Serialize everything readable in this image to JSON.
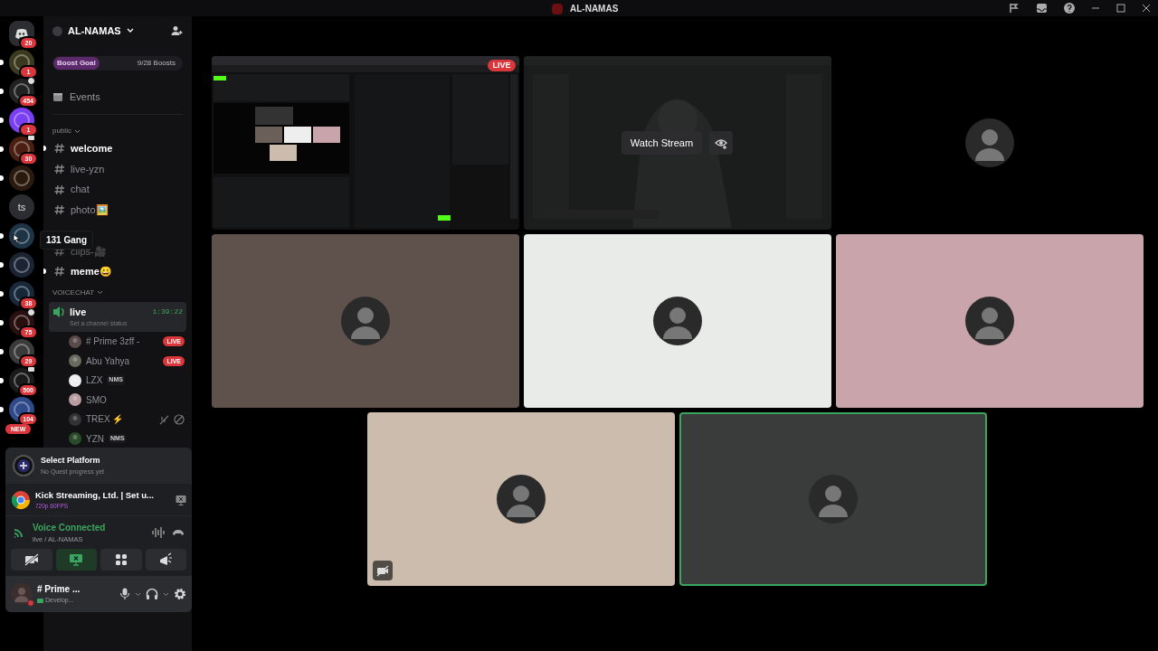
{
  "window": {
    "title": "AL-NAMAS"
  },
  "servers": [
    {
      "kind": "home",
      "badge": "20",
      "unread": false,
      "color": "#2b2d31"
    },
    {
      "kind": "server",
      "badge": "1",
      "unread": true,
      "color": "#3b3a1e"
    },
    {
      "kind": "server",
      "badge": "454",
      "unread": true,
      "speaker": true,
      "color": "#222222"
    },
    {
      "kind": "server",
      "badge": "1",
      "unread": true,
      "color": "#7b3ff2"
    },
    {
      "kind": "server",
      "badge": "30",
      "unread": true,
      "screen": true,
      "color": "#4a1e10"
    },
    {
      "kind": "server",
      "unread": true,
      "color": "#2a1a0e"
    },
    {
      "kind": "text",
      "text": "ts",
      "unread": false,
      "color": "#2b2d31"
    },
    {
      "kind": "server",
      "unread": true,
      "tooltip": "131 Gang",
      "color": "#1d3346"
    },
    {
      "kind": "server",
      "unread": true,
      "color": "#1b2433"
    },
    {
      "kind": "server",
      "badge": "38",
      "unread": true,
      "color": "#16283a"
    },
    {
      "kind": "server",
      "badge": "75",
      "unread": true,
      "speaker": true,
      "color": "#2a0f0f"
    },
    {
      "kind": "server",
      "badge": "29",
      "unread": true,
      "color": "#3a3a3a"
    },
    {
      "kind": "server",
      "badge": "500",
      "unread": true,
      "screen": true,
      "color": "#1a1a1a"
    },
    {
      "kind": "server",
      "badge": "104",
      "unread": true,
      "color": "#2f4a8a",
      "new_label": "NEW"
    }
  ],
  "guild": {
    "name": "AL-NAMAS",
    "boost_label": "Boost Goal",
    "boost_count": "9/28 Boosts",
    "events": "Events"
  },
  "categories": [
    {
      "name": "public",
      "kind": "text",
      "channels": [
        {
          "name": "welcome",
          "unread": true
        },
        {
          "name": "live-yzn",
          "unread": false
        },
        {
          "name": "chat",
          "unread": false
        },
        {
          "name": "photo🖼️",
          "unread": false
        },
        {
          "name": "clips-🎥",
          "unread": false,
          "faded": true
        },
        {
          "name": "meme😀",
          "unread": true
        }
      ]
    },
    {
      "name": "VOICECHAT",
      "kind": "voice",
      "channel": {
        "name": "live",
        "timer": "1:39:22",
        "status": "Set a channel status"
      },
      "users": [
        {
          "name": "# Prime 3zff -",
          "badge": "LIVE",
          "color": "#5a4a4a"
        },
        {
          "name": "Abu Yahya",
          "badge": "LIVE",
          "color": "#6a6a60"
        },
        {
          "name": "LZX",
          "tag": "NMS",
          "color": "#eeeeee"
        },
        {
          "name": "SMO",
          "color": "#b99ca0"
        },
        {
          "name": "TREX ⚡",
          "muted": true,
          "color": "#333333"
        },
        {
          "name": "YZN",
          "tag": "NMS",
          "color": "#2a4a2a"
        }
      ]
    }
  ],
  "quest": {
    "title": "Select Platform",
    "subtitle": "No Quest progress yet"
  },
  "activity": {
    "title": "Kick Streaming, Ltd. | Set u...",
    "quality": "720p 60FPS"
  },
  "voice": {
    "status": "Voice Connected",
    "location": "live / AL-NAMAS"
  },
  "voice_buttons": [
    {
      "kind": "camera",
      "active": false
    },
    {
      "kind": "screen",
      "active": true
    },
    {
      "kind": "activities",
      "active": false
    },
    {
      "kind": "soundboard",
      "active": false
    }
  ],
  "user": {
    "name": "# Prime ...",
    "status": "Develop..."
  },
  "tiles": [
    {
      "kind": "stream",
      "badge": "LIVE"
    },
    {
      "kind": "hidden_stream",
      "button": "Watch Stream"
    },
    {
      "kind": "avatar",
      "color": "#000000",
      "speaking": false
    },
    {
      "kind": "avatar",
      "color": "#5f524d",
      "speaking": false
    },
    {
      "kind": "avatar",
      "color": "#e9ebe9",
      "speaking": false
    },
    {
      "kind": "avatar",
      "color": "#c9a4aa",
      "speaking": false
    },
    {
      "kind": "avatar",
      "color": "#cbbcae",
      "speaking": false,
      "camera_off": true
    },
    {
      "kind": "avatar",
      "color": "#3a3b3b",
      "speaking": true
    }
  ]
}
